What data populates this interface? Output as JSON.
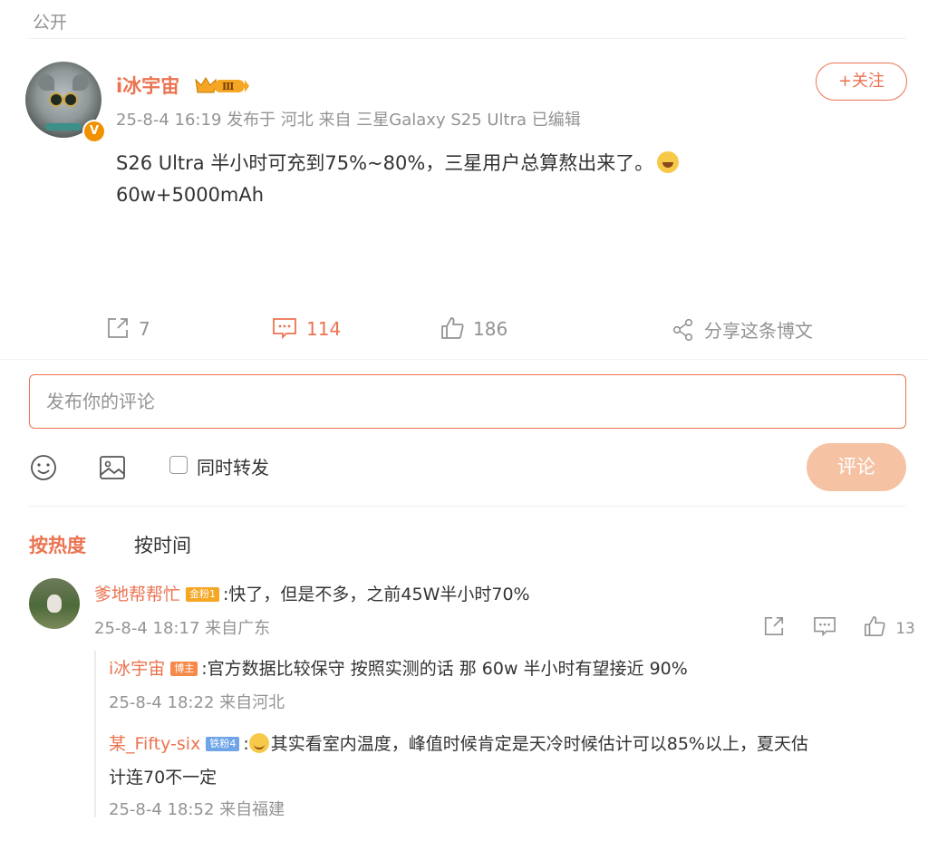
{
  "visibility_label": "公开",
  "post": {
    "author": "i冰宇宙",
    "meta": "25-8-4 16:19 发布于 河北 来自 三星Galaxy S25 Ultra 已编辑",
    "follow_label": "+关注",
    "text_line1": "S26 Ultra 半小时可充到75%~80%，三星用户总算熬出来了。",
    "text_line2": "60w+5000mAh",
    "verified_mark": "V",
    "vip_level": "Ⅲ"
  },
  "actions": {
    "repost_count": "7",
    "comment_count": "114",
    "like_count": "186",
    "share_label": "分享这条博文"
  },
  "composer": {
    "placeholder": "发布你的评论",
    "repost_label": "同时转发",
    "submit_label": "评论"
  },
  "sort": {
    "hot_label": "按热度",
    "time_label": "按时间"
  },
  "comments": [
    {
      "name": "爹地帮帮忙",
      "badge": "金粉1",
      "text": ":快了，但是不多，之前45W半小时70%",
      "meta": "25-8-4 18:17 来自广东",
      "like_count": "13",
      "replies": [
        {
          "name": "i冰宇宙",
          "badge": "博主",
          "text": ":官方数据比较保守   按照实测的话 那 60w 半小时有望接近 90%",
          "meta": "25-8-4 18:22 来自河北"
        },
        {
          "name": "某_Fifty-six",
          "badge": "铁粉4",
          "text_line1": "其实看室内温度，峰值时候肯定是天冷时候估计可以85%以上，夏天估",
          "text_line2": "计连70不一定",
          "prefix": ":",
          "meta": "25-8-4 18:52 来自福建"
        }
      ]
    }
  ],
  "colors": {
    "accent": "#eb7350",
    "muted": "#939393",
    "submit_disabled": "#f5c2a4"
  }
}
